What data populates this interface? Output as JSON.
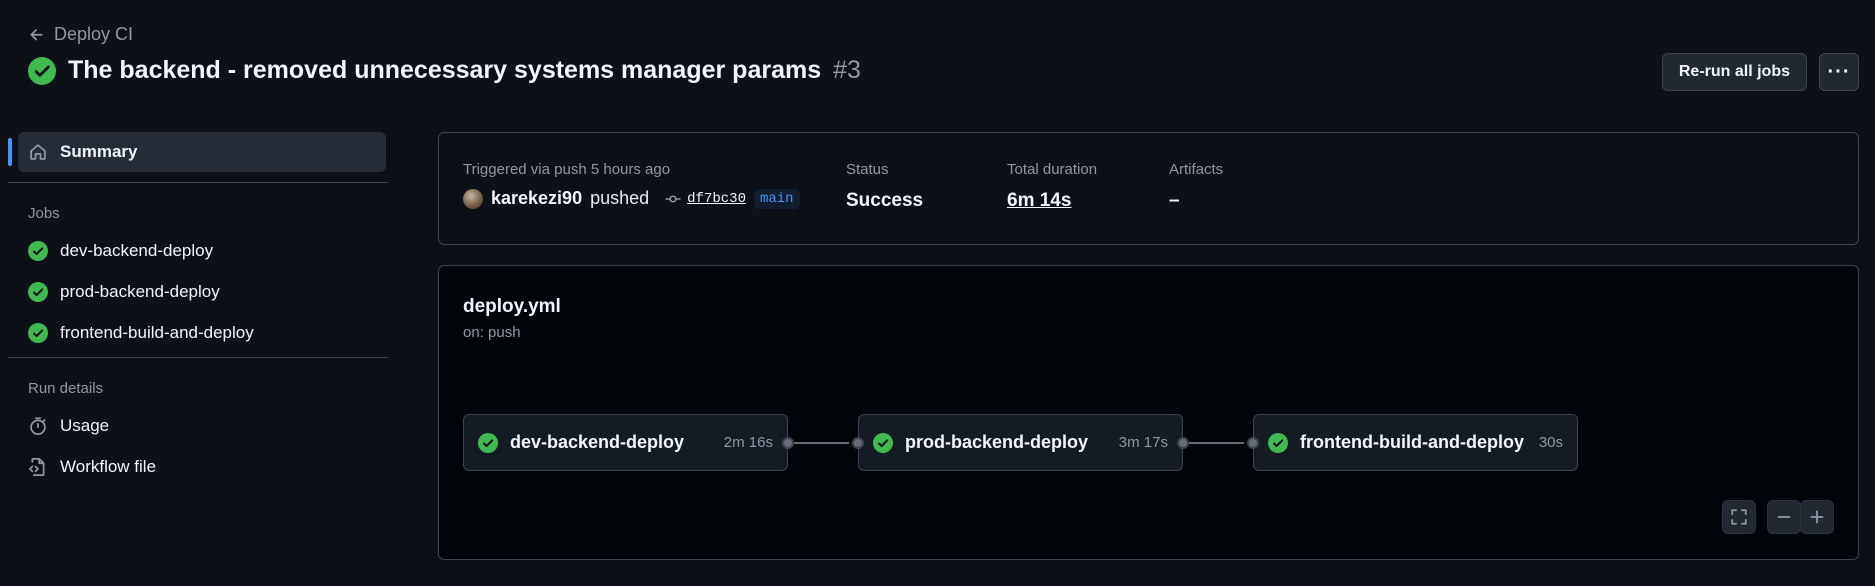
{
  "header": {
    "back_label": "Deploy CI",
    "title": "The backend - removed unnecessary systems manager params",
    "run_number": "#3",
    "rerun_label": "Re-run all jobs",
    "more_label": "···"
  },
  "sidebar": {
    "summary_label": "Summary",
    "jobs_heading": "Jobs",
    "jobs": [
      {
        "label": "dev-backend-deploy"
      },
      {
        "label": "prod-backend-deploy"
      },
      {
        "label": "frontend-build-and-deploy"
      }
    ],
    "run_details_heading": "Run details",
    "usage_label": "Usage",
    "workflow_file_label": "Workflow file"
  },
  "summary": {
    "trigger_text": "Triggered via push 5 hours ago",
    "user": "karekezi90",
    "action": "pushed",
    "commit_sha": "df7bc30",
    "branch": "main",
    "status_label": "Status",
    "status_value": "Success",
    "duration_label": "Total duration",
    "duration_value": "6m 14s",
    "artifacts_label": "Artifacts",
    "artifacts_value": "–"
  },
  "workflow": {
    "file": "deploy.yml",
    "trigger": "on: push",
    "jobs": [
      {
        "name": "dev-backend-deploy",
        "duration": "2m 16s"
      },
      {
        "name": "prod-backend-deploy",
        "duration": "3m 17s"
      },
      {
        "name": "frontend-build-and-deploy",
        "duration": "30s"
      }
    ]
  },
  "colors": {
    "success": "#3fb950",
    "accent": "#4493f8",
    "background": "#0d1117"
  }
}
